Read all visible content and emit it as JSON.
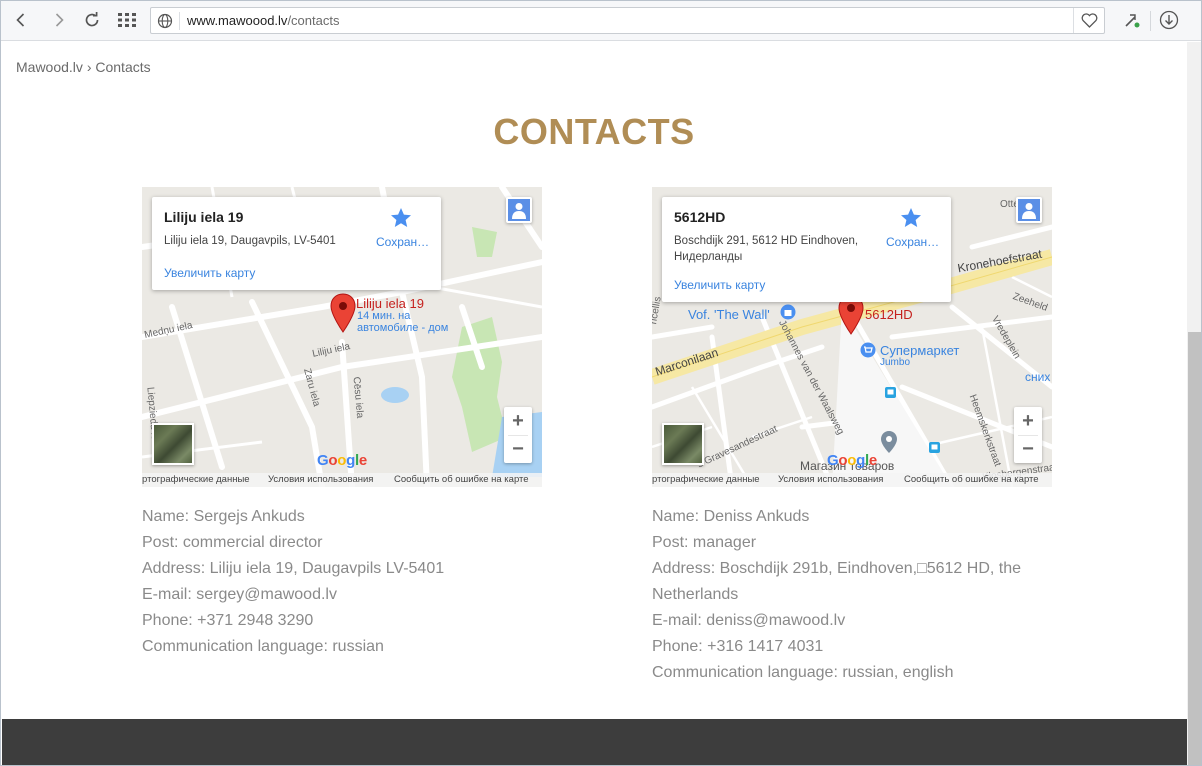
{
  "browser": {
    "url_domain": "www.mawoood.lv",
    "url_path": "/contacts"
  },
  "breadcrumb": {
    "home": "Mawood.lv",
    "separator": "›",
    "current": "Contacts"
  },
  "page_title": "CONTACTS",
  "colors": {
    "title": "#b08d55",
    "text": "#8a8a8a",
    "footer": "#3d3d3d",
    "link": "#3a84df"
  },
  "maps": [
    {
      "card_title": "Liliju iela 19",
      "card_address": "Liliju iela 19, Daugavpils, LV-5401",
      "save_label": "Сохран…",
      "enlarge_label": "Увеличить карту",
      "pin_label": "Liliju iela 19",
      "pin_sub1": "14 мин. на",
      "pin_sub2": "автомобиле - дом",
      "street_labels": [
        "Medņu iela",
        "Liliju iela",
        "Zaru iela",
        "Cēsu iela",
        "Liepziedu iela"
      ],
      "attribution": [
        "ртографические данные",
        "Условия использования",
        "Сообщить об ошибке на карте"
      ],
      "google": "Google"
    },
    {
      "card_title": "5612HD",
      "card_address": "Boschdijk 291, 5612 HD Eindhoven, Нидерланды",
      "save_label": "Сохран…",
      "enlarge_label": "Увеличить карту",
      "pin_label": "5612HD",
      "street_labels": [
        "Kronehoefstraat",
        "Marconilaan",
        "Vof. 'The Wall'",
        "Супермаркет",
        "Jumbo",
        "Магазин товаров",
        "Otterstra",
        "Zeeheld",
        "Vredeplein",
        "сних",
        "Heemskerkstraat",
        "Johannes van der Waalsweg",
        "'s Gravesandestraat",
        "Klosbergenstraat",
        "ricellis"
      ],
      "attribution": [
        "ртографические данные",
        "Условия использования",
        "Сообщить об ошибке на карте"
      ],
      "google": "Google"
    }
  ],
  "contacts": [
    {
      "name": "Name: Sergejs Ankuds",
      "post": "Post: commercial director",
      "address": "Address: Liliju iela 19, Daugavpils LV-5401",
      "email": "E-mail: sergey@mawood.lv",
      "phone": "Phone: +371 2948 3290",
      "language": "Communication language: russian"
    },
    {
      "name": "Name: Deniss Ankuds",
      "post": "Post: manager",
      "address_line1": "Address: Boschdijk 291b, Eindhoven,□5612 HD, the",
      "address_line2": "Netherlands",
      "email": "E-mail: deniss@mawood.lv",
      "phone": "Phone: +316 1417 4031",
      "language": "Communication language: russian, english"
    }
  ]
}
